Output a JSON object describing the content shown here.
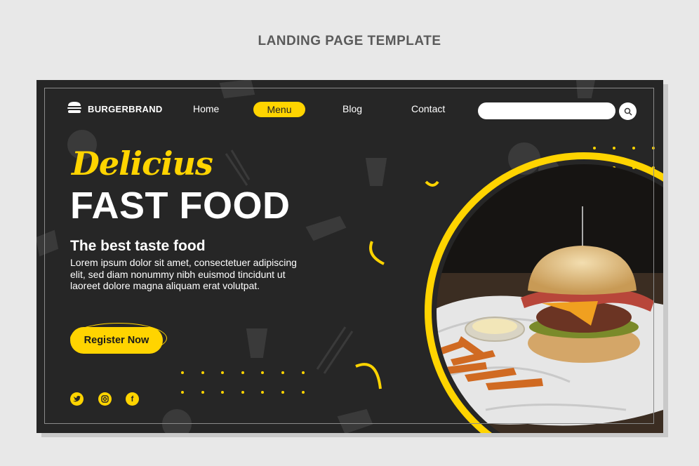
{
  "caption": "LANDING PAGE TEMPLATE",
  "brand": {
    "name": "BURGERBRAND",
    "logo_icon": "burger-icon"
  },
  "nav": {
    "home": "Home",
    "menu": "Menu",
    "blog": "Blog",
    "contact": "Contact"
  },
  "search": {
    "placeholder": "",
    "value": "",
    "icon": "search-icon"
  },
  "hero": {
    "script_title": "Delicius",
    "title": "FAST FOOD",
    "subtitle": "The best taste food",
    "body": "Lorem ipsum dolor sit amet, consectetuer adipiscing elit, sed diam nonummy nibh euismod tincidunt ut laoreet dolore magna aliquam erat volutpat.",
    "cta": "Register Now"
  },
  "social": {
    "twitter": "twitter-icon",
    "instagram": "instagram-icon",
    "facebook": "facebook-icon",
    "facebook_glyph": "f"
  },
  "colors": {
    "accent": "#ffd400",
    "background": "#262626",
    "page": "#e8e8e8",
    "text": "#ffffff"
  }
}
